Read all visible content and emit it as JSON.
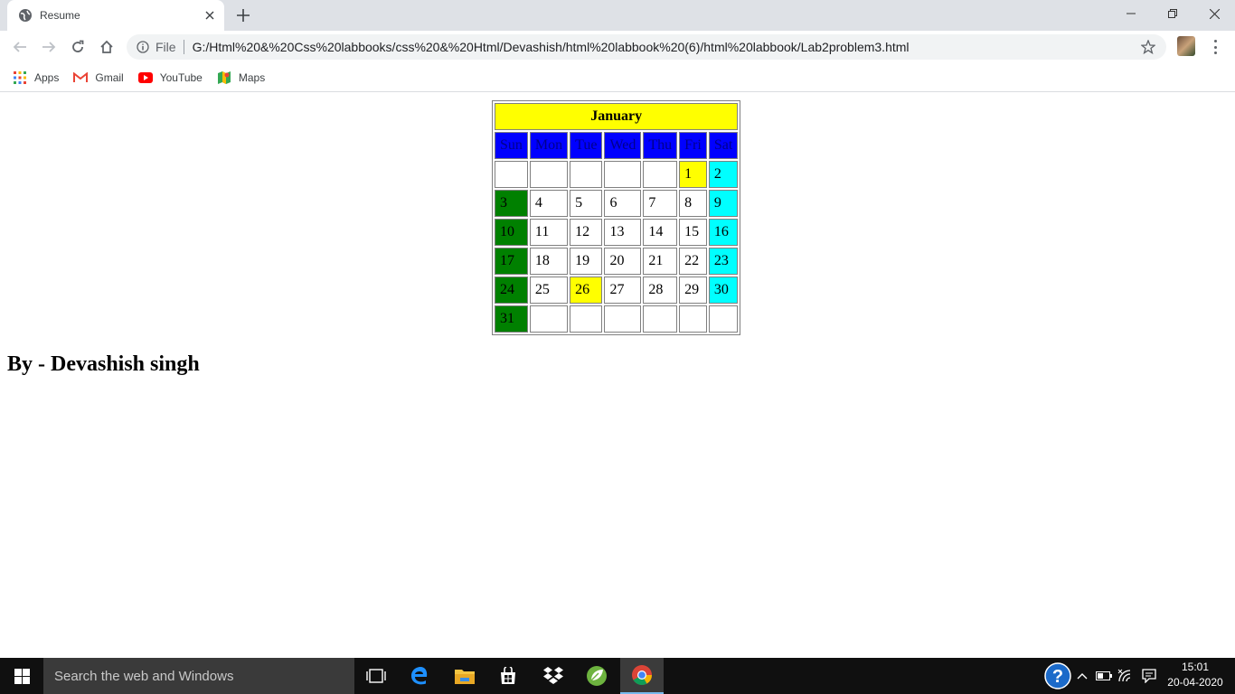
{
  "browser": {
    "tab": {
      "title": "Resume"
    },
    "address": {
      "scheme_label": "File",
      "url": "G:/Html%20&%20Css%20labbooks/css%20&%20Html/Devashish/html%20labbook%20(6)/html%20labbook/Lab2problem3.html"
    },
    "bookmarks": [
      {
        "label": "Apps",
        "icon": "apps-grid-icon"
      },
      {
        "label": "Gmail",
        "icon": "gmail-icon"
      },
      {
        "label": "YouTube",
        "icon": "youtube-icon"
      },
      {
        "label": "Maps",
        "icon": "maps-icon"
      }
    ]
  },
  "calendar": {
    "month": "January",
    "days_of_week": [
      "Sun",
      "Mon",
      "Tue",
      "Wed",
      "Thu",
      "Fri",
      "Sat"
    ],
    "weeks": [
      [
        "",
        "",
        "",
        "",
        "",
        "1",
        "2"
      ],
      [
        "3",
        "4",
        "5",
        "6",
        "7",
        "8",
        "9"
      ],
      [
        "10",
        "11",
        "12",
        "13",
        "14",
        "15",
        "16"
      ],
      [
        "17",
        "18",
        "19",
        "20",
        "21",
        "22",
        "23"
      ],
      [
        "24",
        "25",
        "26",
        "27",
        "28",
        "29",
        "30"
      ],
      [
        "31",
        "",
        "",
        "",
        "",
        "",
        ""
      ]
    ],
    "colors": {
      "header": "#ffff00",
      "dow_background": "#0000ff",
      "sunday": "#008000",
      "saturday": "#00ffff",
      "highlight": "#ffff00"
    },
    "highlighted_days": [
      "1",
      "26"
    ]
  },
  "byline": "By - Devashish singh",
  "taskbar": {
    "search_placeholder": "Search the web and Windows",
    "clock": {
      "time": "15:01",
      "date": "20-04-2020"
    }
  }
}
